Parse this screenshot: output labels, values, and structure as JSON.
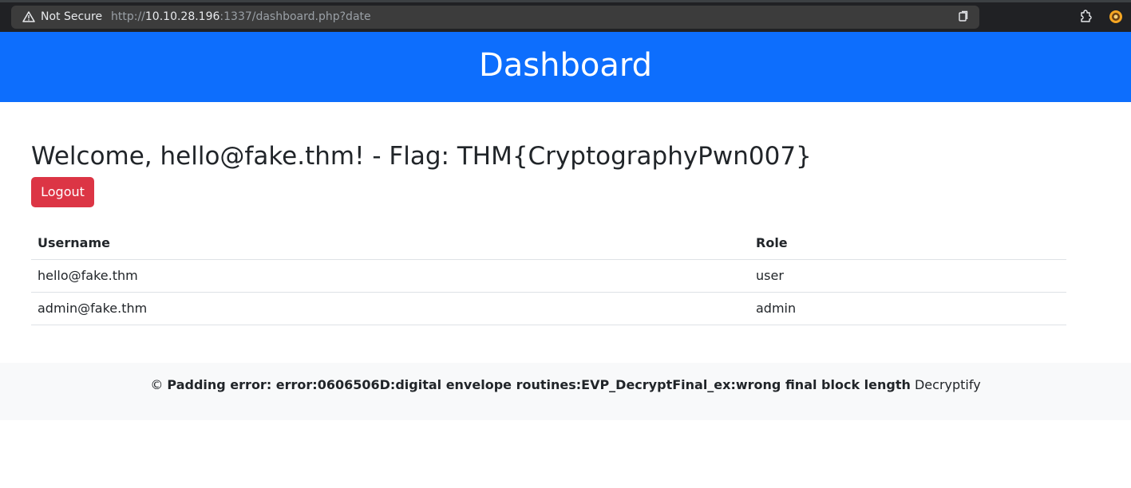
{
  "browser": {
    "security_label": "Not Secure",
    "url_scheme": "http://",
    "url_host": "10.10.28.196",
    "url_rest": ":1337/dashboard.php?date",
    "icons": {
      "security": "warning-triangle-icon",
      "bookmark": "reading-list-icon",
      "extension": "extension-puzzle-icon",
      "profile": "profile-avatar-icon"
    }
  },
  "header": {
    "title": "Dashboard",
    "background": "#0d6efd"
  },
  "main": {
    "welcome": "Welcome, hello@fake.thm! - Flag: THM{CryptographyPwn007}",
    "logout_label": "Logout",
    "logout_color": "#dc3545",
    "table": {
      "headers": [
        "Username",
        "Role"
      ],
      "rows": [
        [
          "hello@fake.thm",
          "user"
        ],
        [
          "admin@fake.thm",
          "admin"
        ]
      ]
    }
  },
  "footer": {
    "copyright": "©",
    "error_text": "Padding error: error:0606506D:digital envelope routines:EVP_DecryptFinal_ex:wrong final block length",
    "brand": "Decryptify"
  }
}
